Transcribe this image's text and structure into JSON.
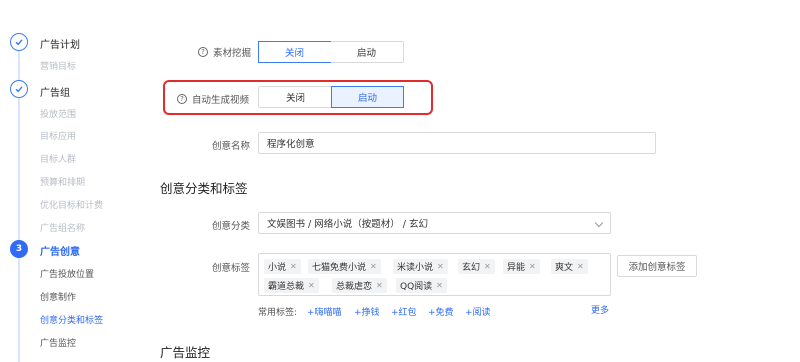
{
  "sidebar": {
    "steps": [
      {
        "title": "广告计划",
        "subs": [
          "营销目标"
        ]
      },
      {
        "title": "广告组",
        "subs": [
          "投放范围",
          "目标应用",
          "目标人群",
          "预算和排期",
          "优化目标和计费",
          "广告组名称"
        ]
      },
      {
        "number": "3",
        "title": "广告创意",
        "subs": [
          "广告投放位置",
          "创意制作",
          "创意分类和标签",
          "广告监控"
        ]
      }
    ]
  },
  "form": {
    "material_mining": {
      "label": "素材挖掘",
      "options": [
        "关闭",
        "启动"
      ],
      "selected": "关闭"
    },
    "auto_video": {
      "label": "自动生成视频",
      "options": [
        "关闭",
        "启动"
      ],
      "selected": "启动"
    },
    "creative_name": {
      "label": "创意名称",
      "value": "程序化创意"
    }
  },
  "category_section": {
    "title": "创意分类和标签",
    "category": {
      "label": "创意分类",
      "value": "文娱图书 / 网络小说（按题材） / 玄幻"
    },
    "tags": {
      "label": "创意标签",
      "items": [
        "小说",
        "七猫免费小说",
        "米读小说",
        "玄幻",
        "异能",
        "爽文",
        "霸道总裁",
        "总裁虐恋",
        "QQ阅读"
      ],
      "add_button": "添加创意标签",
      "common_label": "常用标签:",
      "common": [
        "+嗨喵喵",
        "+挣钱",
        "+红包",
        "+免费",
        "+阅读"
      ],
      "more": "更多"
    }
  },
  "monitor_section": {
    "title": "广告监控"
  },
  "colors": {
    "accent": "#2f6bf5",
    "highlight": "#e42b2b"
  }
}
